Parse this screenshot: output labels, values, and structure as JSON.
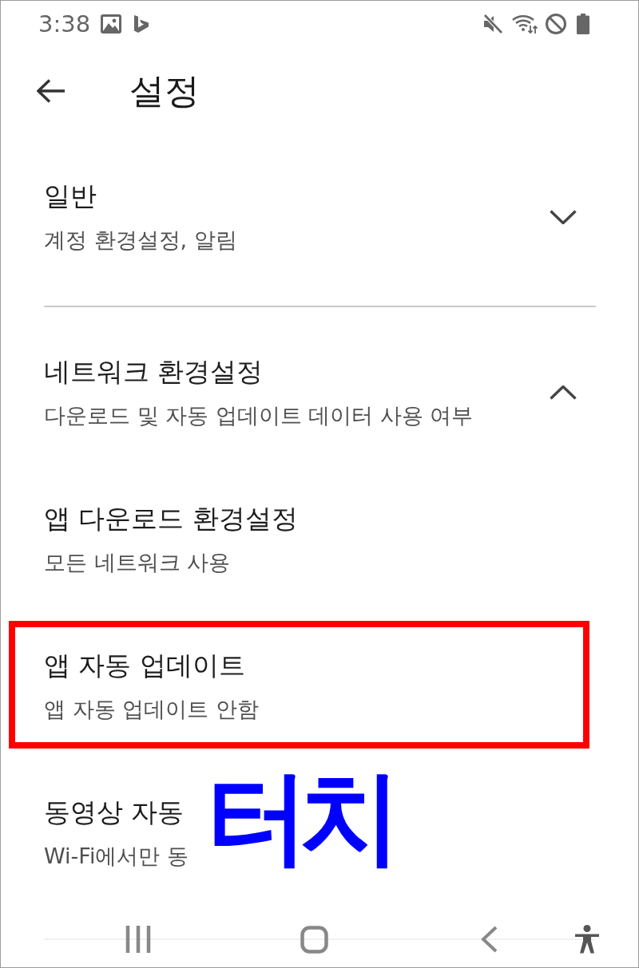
{
  "status_bar": {
    "time": "3:38"
  },
  "app_bar": {
    "title": "설정"
  },
  "sections": [
    {
      "title": "일반",
      "subtitle": "계정 환경설정, 알림",
      "expanded": false
    },
    {
      "title": "네트워크 환경설정",
      "subtitle": "다운로드 및 자동 업데이트 데이터 사용 여부",
      "expanded": true,
      "items": [
        {
          "title": "앱 다운로드 환경설정",
          "subtitle": "모든 네트워크 사용",
          "highlighted": false
        },
        {
          "title": "앱 자동 업데이트",
          "subtitle": "앱 자동 업데이트 안함",
          "highlighted": true
        },
        {
          "title": "동영상 자동",
          "subtitle": "Wi-Fi에서만 동",
          "highlighted": false
        }
      ]
    }
  ],
  "annotation": {
    "label": "터치"
  }
}
